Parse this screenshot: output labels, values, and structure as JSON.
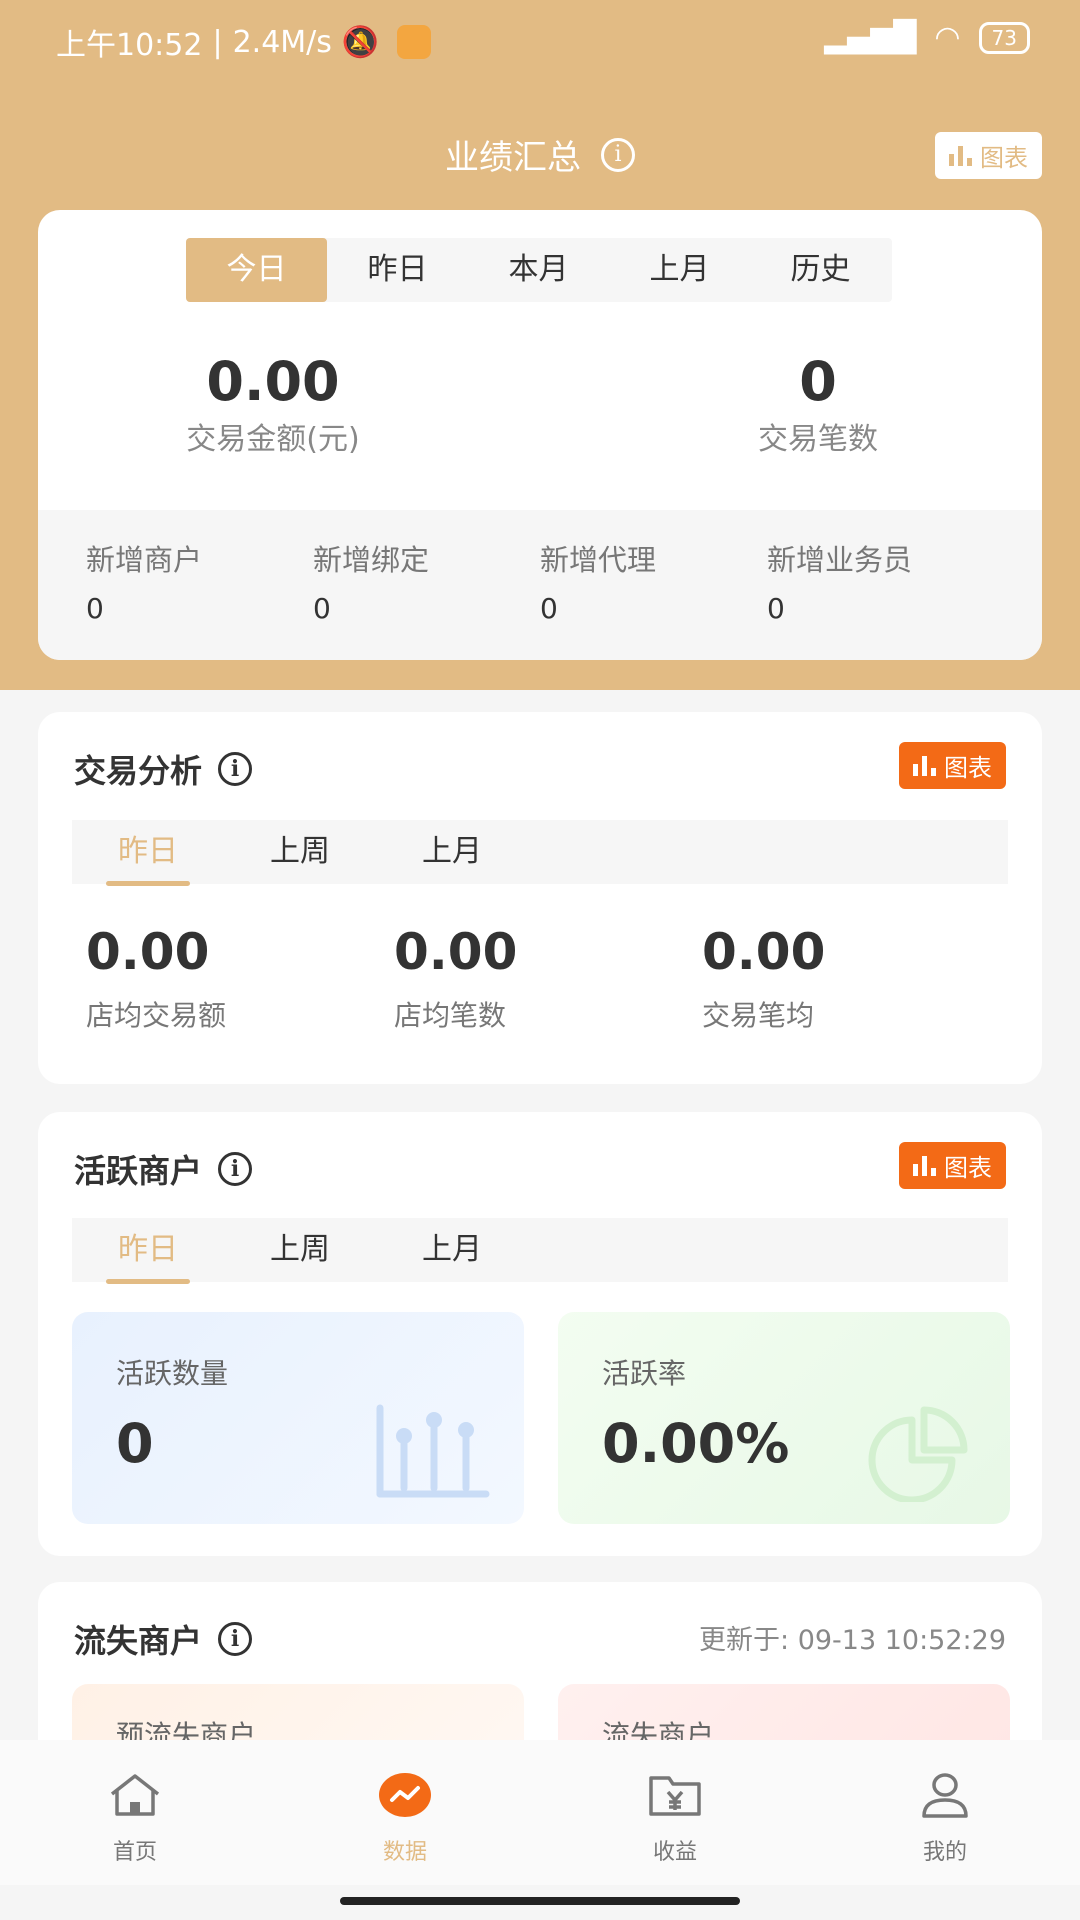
{
  "status_bar": {
    "time": "上午10:52",
    "speed": "2.4M/s",
    "battery": "73"
  },
  "header": {
    "title": "业绩汇总",
    "chart_label": "图表"
  },
  "summary": {
    "tabs": [
      "今日",
      "昨日",
      "本月",
      "上月",
      "历史"
    ],
    "amount_value": "0.00",
    "amount_label": "交易金额(元)",
    "count_value": "0",
    "count_label": "交易笔数",
    "stats": [
      {
        "label": "新增商户",
        "value": "0"
      },
      {
        "label": "新增绑定",
        "value": "0"
      },
      {
        "label": "新增代理",
        "value": "0"
      },
      {
        "label": "新增业务员",
        "value": "0"
      }
    ]
  },
  "trade_analysis": {
    "title": "交易分析",
    "chart_label": "图表",
    "tabs": [
      "昨日",
      "上周",
      "上月"
    ],
    "metrics": [
      {
        "value": "0.00",
        "label": "店均交易额"
      },
      {
        "value": "0.00",
        "label": "店均笔数"
      },
      {
        "value": "0.00",
        "label": "交易笔均"
      }
    ]
  },
  "active_merchants": {
    "title": "活跃商户",
    "chart_label": "图表",
    "tabs": [
      "昨日",
      "上周",
      "上月"
    ],
    "count_label": "活跃数量",
    "count_value": "0",
    "rate_label": "活跃率",
    "rate_value": "0.00%"
  },
  "lost_merchants": {
    "title": "流失商户",
    "updated": "更新于: 09-13 10:52:29",
    "pre_lost_label": "预流失商户",
    "lost_label": "流失商户"
  },
  "nav": [
    {
      "label": "首页",
      "icon": "home-icon"
    },
    {
      "label": "数据",
      "icon": "data-icon"
    },
    {
      "label": "收益",
      "icon": "income-icon"
    },
    {
      "label": "我的",
      "icon": "profile-icon"
    }
  ],
  "colors": {
    "brand": "#e2bb84",
    "accent": "#f36a16"
  }
}
